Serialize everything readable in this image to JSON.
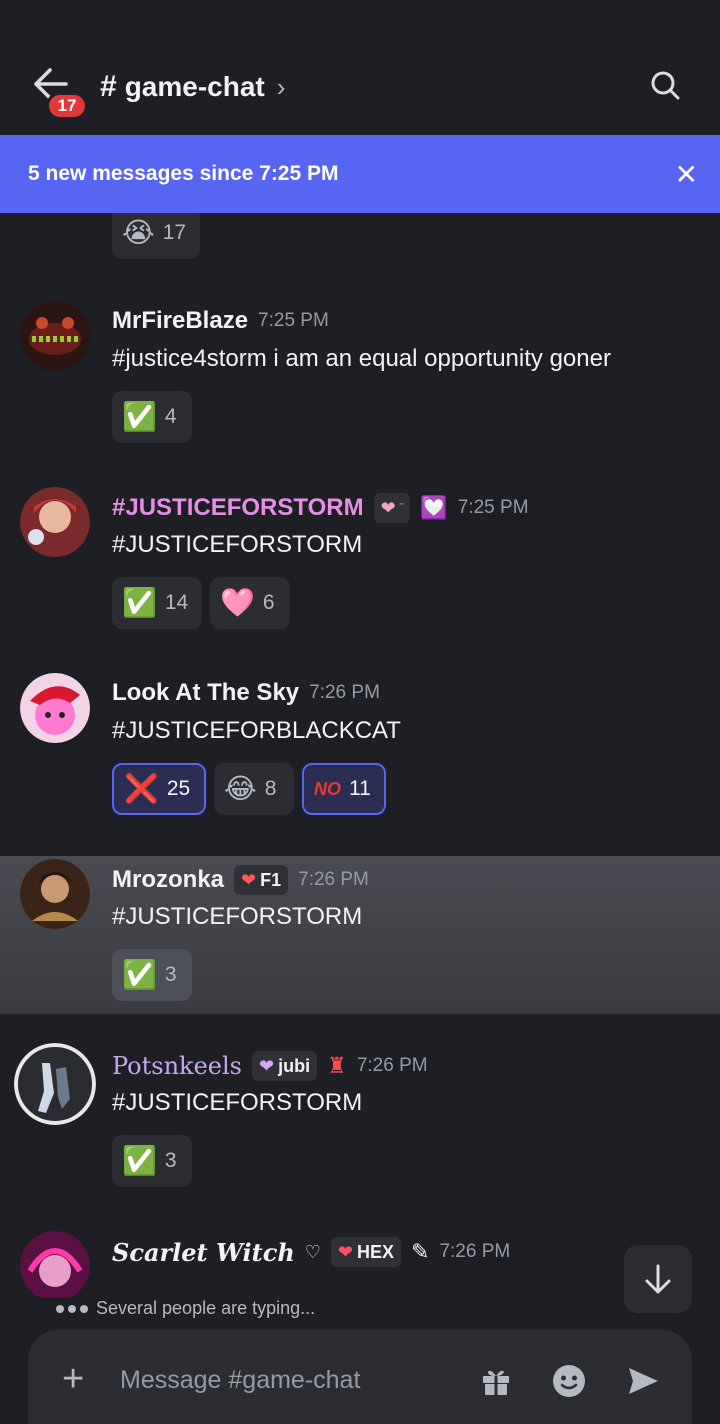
{
  "header": {
    "back_badge": "17",
    "hash": "#",
    "channel_name": "game-chat",
    "chevron": "›"
  },
  "banner": {
    "text": "5 new messages since 7:25 PM",
    "close": "✕"
  },
  "top_reaction": {
    "emoji": "😭",
    "count": "17"
  },
  "messages": [
    {
      "username": "MrFireBlaze",
      "time": "7:25 PM",
      "text": "#justice4storm i am an equal opportunity goner",
      "reactions": [
        {
          "emoji": "✅",
          "count": "4"
        }
      ]
    },
    {
      "username": "#JUSTICEFORSTORM",
      "name_color": "#e58fe3",
      "time": "7:25 PM",
      "text": "#JUSTICEFORSTORM",
      "reactions": [
        {
          "emoji": "✅",
          "count": "14"
        },
        {
          "emoji": "🩷",
          "count": "6"
        }
      ]
    },
    {
      "username": "Look At The Sky",
      "time": "7:26 PM",
      "text": "#JUSTICEFORBLACKCAT",
      "reactions": [
        {
          "emoji": "❌",
          "count": "25"
        },
        {
          "emoji": "😂",
          "count": "8"
        },
        {
          "emoji": "NO",
          "count": "11"
        }
      ]
    },
    {
      "username": "Mrozonka",
      "tag": "F1",
      "time": "7:26 PM",
      "text": "#JUSTICEFORSTORM",
      "reactions": [
        {
          "emoji": "✅",
          "count": "3"
        }
      ]
    },
    {
      "username": "Potsnkeels",
      "name_color": "#c7a8f0",
      "tag": "jubi",
      "time": "7:26 PM",
      "text": "#JUSTICEFORSTORM",
      "reactions": [
        {
          "emoji": "✅",
          "count": "3"
        }
      ]
    },
    {
      "username": "Scarlet Witch",
      "tag": "HEX",
      "time": "7:26 PM"
    }
  ],
  "typing_text": "Several people are typing...",
  "composer": {
    "placeholder": "Message #game-chat",
    "plus": "+"
  },
  "colors": {
    "accent": "#5865f2",
    "background": "#1e1f24",
    "badge": "#e13939"
  }
}
